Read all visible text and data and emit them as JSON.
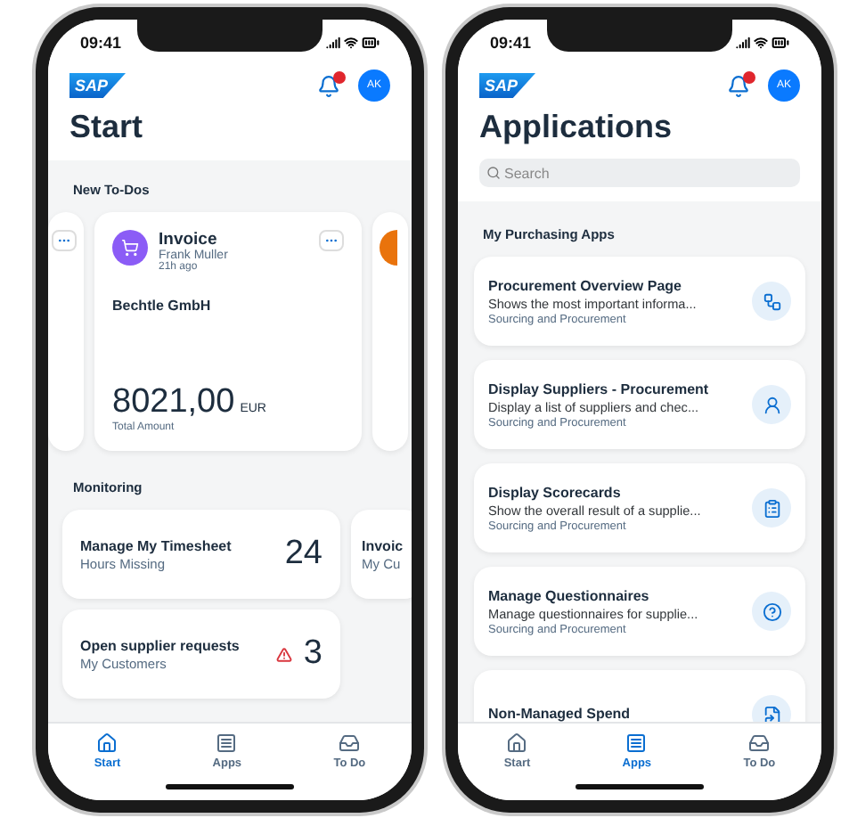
{
  "phones": [
    {
      "kind": "start",
      "time": "09:41",
      "logo": "SAP",
      "avatar": "AK",
      "title": "Start",
      "todos": {
        "heading": "New To-Dos",
        "card": {
          "title": "Invoice",
          "person": "Frank Muller",
          "age": "21h ago",
          "company": "Bechtle GmbH",
          "amount": "8021,00",
          "currency": "EUR",
          "amount_label": "Total Amount"
        }
      },
      "monitoring": {
        "heading": "Monitoring",
        "tiles": [
          {
            "kind": "full",
            "title": "Manage My Timesheet",
            "subtitle": "Hours Missing",
            "value": "24",
            "warning": false
          },
          {
            "kind": "clipped",
            "title": "Invoic",
            "subtitle": "My Cu"
          },
          {
            "kind": "full",
            "title": "Open supplier requests",
            "subtitle": "My Customers",
            "value": "3",
            "warning": true
          }
        ]
      },
      "tabs": [
        {
          "label": "Start",
          "selected": true
        },
        {
          "label": "Apps",
          "selected": false
        },
        {
          "label": "To Do",
          "selected": false
        }
      ]
    },
    {
      "kind": "apps",
      "time": "09:41",
      "logo": "SAP",
      "avatar": "AK",
      "title": "Applications",
      "search": {
        "placeholder": "Search"
      },
      "section": "My Purchasing Apps",
      "apps": [
        {
          "title": "Procurement Overview Page",
          "description": "Shows the most important informa...",
          "area": "Sourcing and Procurement"
        },
        {
          "title": "Display Suppliers - Procurement",
          "description": "Display a list of suppliers and chec...",
          "area": "Sourcing and Procurement"
        },
        {
          "title": "Display Scorecards",
          "description": "Show the overall result of a supplie...",
          "area": "Sourcing and Procurement"
        },
        {
          "title": "Manage Questionnaires",
          "description": "Manage questionnaires for supplie...",
          "area": "Sourcing and Procurement"
        },
        {
          "title": "Non-Managed Spend"
        }
      ],
      "tabs": [
        {
          "label": "Start",
          "selected": false
        },
        {
          "label": "Apps",
          "selected": true
        },
        {
          "label": "To Do",
          "selected": false
        }
      ]
    }
  ]
}
